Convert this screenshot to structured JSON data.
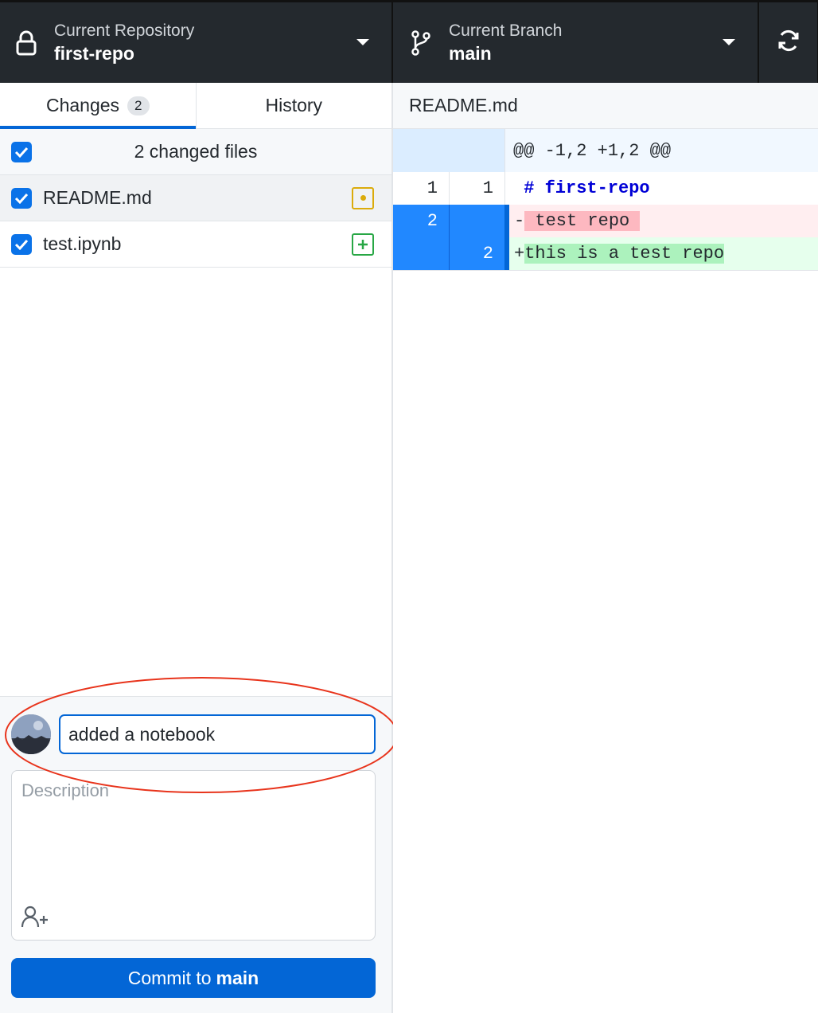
{
  "toolbar": {
    "repository": {
      "label": "Current Repository",
      "value": "first-repo"
    },
    "branch": {
      "label": "Current Branch",
      "value": "main"
    }
  },
  "tabs": [
    {
      "label": "Changes",
      "count": "2",
      "active": true
    },
    {
      "label": "History",
      "active": false
    }
  ],
  "changes": {
    "summary": "2 changed files",
    "files": [
      {
        "name": "README.md",
        "status": "modified",
        "status_color": "#dbab0a"
      },
      {
        "name": "test.ipynb",
        "status": "added",
        "status_color": "#28a745"
      }
    ]
  },
  "commit": {
    "summary_value": "added a notebook",
    "description_placeholder": "Description",
    "button_prefix": "Commit to",
    "button_branch": "main"
  },
  "diff": {
    "file_name": "README.md",
    "hunk_header": "@@ -1,2 +1,2 @@",
    "lines": [
      {
        "type": "ctx",
        "old": "1",
        "new": "1",
        "prefix": " ",
        "text": "# first-repo"
      },
      {
        "type": "del",
        "old": "2",
        "new": "",
        "prefix": "-",
        "text": " test repo "
      },
      {
        "type": "add",
        "old": "",
        "new": "2",
        "prefix": "+",
        "text": "this is a test repo"
      }
    ]
  },
  "colors": {
    "accent": "#0366d6",
    "toolbar_bg": "#24292e",
    "annotation": "#e8341c"
  }
}
